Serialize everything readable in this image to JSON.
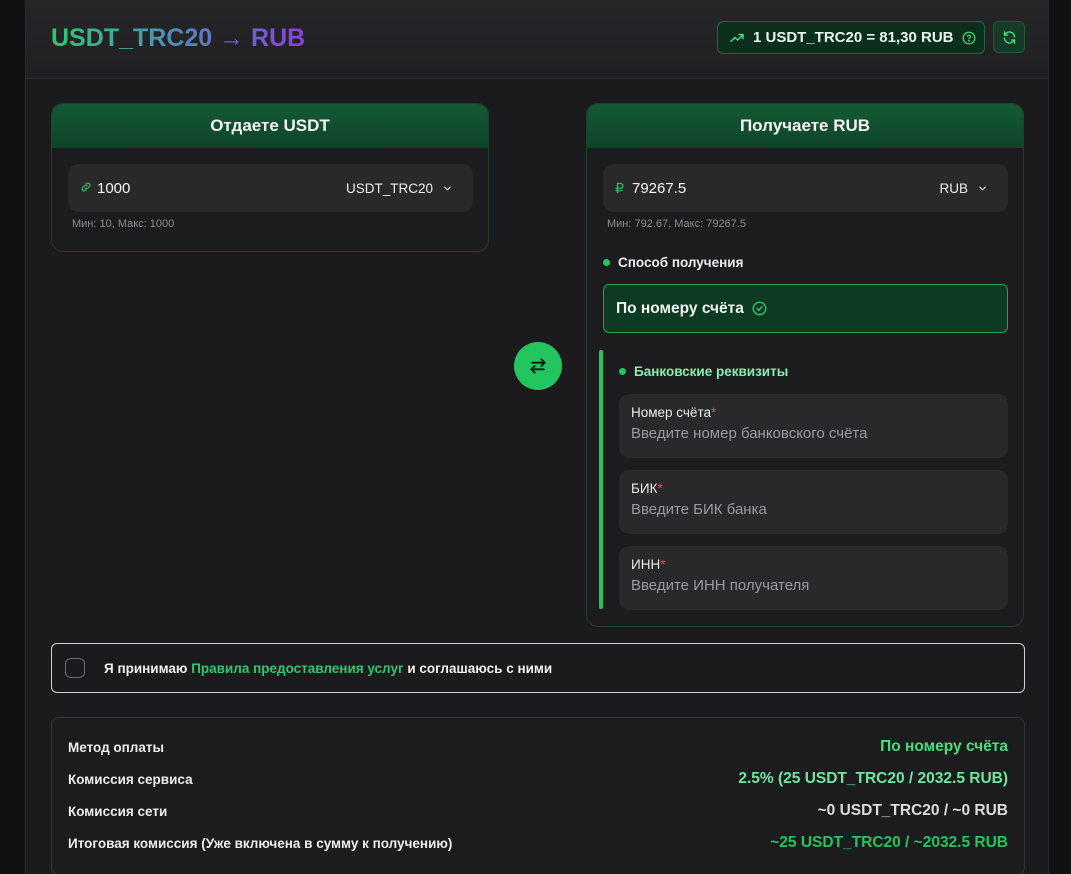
{
  "header": {
    "title": "USDT_TRC20 → RUB",
    "rate": "1 USDT_TRC20 = 81,30 RUB"
  },
  "give": {
    "title": "Отдаете USDT",
    "amount": "1000",
    "currency": "USDT_TRC20",
    "limits": "Мин: 10, Макс: 1000"
  },
  "receive": {
    "title": "Получаете RUB",
    "currency_symbol": "₽",
    "amount": "79267.5",
    "currency": "RUB",
    "limits": "Мин: 792.67, Макс: 79267.5",
    "method_label": "Способ получения",
    "method_value": "По номеру счёта",
    "requisites_label": "Банковские реквизиты",
    "fields": [
      {
        "label": "Номер счёта",
        "placeholder": "Введите номер банковского счёта"
      },
      {
        "label": "БИК",
        "placeholder": "Введите БИК банка"
      },
      {
        "label": "ИНН",
        "placeholder": "Введите ИНН получателя"
      }
    ],
    "required_mark": "*"
  },
  "terms": {
    "prefix": "Я принимаю ",
    "link": "Правила предоставления услуг",
    "suffix": " и соглашаюсь с ними"
  },
  "summary": {
    "rows": [
      {
        "key": "Метод оплаты",
        "value": "По номеру счёта"
      },
      {
        "key": "Комиссия сервиса",
        "value": "2.5% (25 USDT_TRC20 / 2032.5 RUB)"
      },
      {
        "key": "Комиссия сети",
        "value": "~0 USDT_TRC20 / ~0 RUB"
      },
      {
        "key": "Итоговая комиссия (Уже включена в сумму к получению)",
        "value": "~25 USDT_TRC20 / ~2032.5 RUB"
      }
    ]
  },
  "colors": {
    "accent": "#22c55e",
    "header_green": "#145a34",
    "required": "#e5484d"
  }
}
